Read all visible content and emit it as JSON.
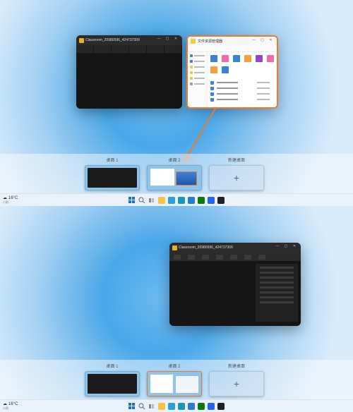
{
  "classroom_window": {
    "title": "Classroom_20980596_424737309",
    "window_controls": {
      "min": "—",
      "max": "▢",
      "close": "✕"
    }
  },
  "explorer_window": {
    "title": "文件资源管理器",
    "window_controls": {
      "min": "—",
      "max": "▢",
      "close": "✕"
    }
  },
  "desktop_strip": {
    "desktops": [
      {
        "label": "桌面 1"
      },
      {
        "label": "桌面 2"
      }
    ],
    "new_label": "新建桌面",
    "new_glyph": "+"
  },
  "taskbar": {
    "weather_temp": "16°C",
    "weather_sub": "小雨",
    "weather_icon": "☁",
    "icons": {
      "start": "start-icon",
      "search": "search-icon",
      "taskview": "taskview-icon",
      "explorer": "explorer-icon",
      "edge": "edge-icon",
      "store": "store-icon",
      "mail": "mail-icon",
      "xbox": "xbox-icon",
      "vscode": "vscode-icon",
      "steam": "steam-icon"
    },
    "icon_colors": {
      "start": "#1f6fd0",
      "search": "#e0e0e0",
      "taskview": "#5c5c5c",
      "explorer": "#f5c445",
      "edge": "#2aa0d8",
      "store": "#1a97b5",
      "mail": "#2a7bd0",
      "xbox": "#0e7a0d",
      "vscode": "#2563eb",
      "steam": "#222222"
    }
  },
  "colors": {
    "highlight": "#ec7a2a"
  },
  "explorer_tiles": [
    "#3b82d4",
    "#ef6aa7",
    "#3b82d4",
    "#f0a23c",
    "#9248c7",
    "#ef6aa7",
    "#f0a23c",
    "#3b82d4"
  ]
}
